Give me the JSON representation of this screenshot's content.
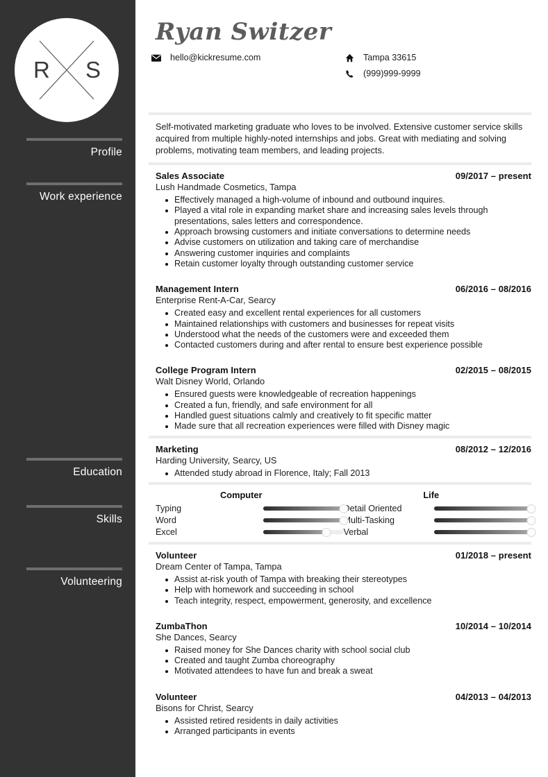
{
  "logo": {
    "left_letter": "R",
    "right_letter": "S"
  },
  "sidebar": {
    "sections": [
      {
        "label": "Profile"
      },
      {
        "label": "Work experience"
      },
      {
        "label": "Education"
      },
      {
        "label": "Skills"
      },
      {
        "label": "Volunteering"
      }
    ]
  },
  "header": {
    "name": "Ryan Switzer",
    "email": "hello@kickresume.com",
    "address": "Tampa 33615",
    "phone": "(999)999-9999",
    "email_icon": "envelope-icon",
    "address_icon": "home-icon",
    "phone_icon": "phone-icon"
  },
  "profile": {
    "text": "Self-motivated marketing graduate who loves to be involved. Extensive customer service skills acquired from multiple highly-noted internships and jobs. Great with mediating and solving problems, motivating team members, and leading projects."
  },
  "work_experience": [
    {
      "title": "Sales Associate",
      "date": "09/2017 – present",
      "organization": "Lush Handmade Cosmetics, Tampa",
      "bullets": [
        "Effectively managed a high-volume of inbound and outbound inquires.",
        "Played a vital role in expanding market share and increasing sales levels through presentations, sales letters and correspondence.",
        "Approach browsing customers and initiate conversations to determine needs",
        "Advise customers on utilization and taking care of merchandise",
        "Answering customer inquiries and complaints",
        "Retain customer loyalty through outstanding customer service"
      ]
    },
    {
      "title": "Management Intern",
      "date": "06/2016 – 08/2016",
      "organization": "Enterprise Rent-A-Car, Searcy",
      "bullets": [
        "Created easy and excellent rental experiences for all customers",
        "Maintained relationships with customers and businesses for repeat visits",
        "Understood what the needs of the customers were and exceeded them",
        "Contacted customers during and after rental to ensure best experience possible"
      ]
    },
    {
      "title": "College Program Intern",
      "date": "02/2015 – 08/2015",
      "organization": "Walt Disney World, Orlando",
      "bullets": [
        "Ensured guests were knowledgeable of recreation happenings",
        "Created a fun, friendly, and safe environment for all",
        "Handled guest situations calmly and creatively to fit specific matter",
        "Made sure that all recreation experiences were filled with Disney magic"
      ]
    }
  ],
  "education": [
    {
      "title": "Marketing",
      "date": "08/2012 – 12/2016",
      "organization": "Harding University, Searcy, US",
      "bullets": [
        "Attended study abroad in Florence, Italy; Fall 2013"
      ]
    }
  ],
  "skills": {
    "columns": [
      {
        "heading": "Computer"
      },
      {
        "heading": "Life"
      }
    ],
    "computer": [
      {
        "name": "Typing",
        "level": 100
      },
      {
        "name": "Word",
        "level": 100
      },
      {
        "name": "Excel",
        "level": 79
      }
    ],
    "life": [
      {
        "name": "Detail Oriented",
        "level": 100
      },
      {
        "name": "Multi-Tasking",
        "level": 100
      },
      {
        "name": "Verbal",
        "level": 100
      }
    ]
  },
  "volunteering": [
    {
      "title": "Volunteer",
      "date": "01/2018 – present",
      "organization": "Dream Center of Tampa, Tampa",
      "bullets": [
        "Assist at-risk youth of Tampa with breaking their stereotypes",
        "Help with homework and succeeding in school",
        "Teach integrity, respect, empowerment, generosity, and excellence"
      ]
    },
    {
      "title": "ZumbaThon",
      "date": "10/2014 – 10/2014",
      "organization": "She Dances, Searcy",
      "bullets": [
        "Raised money for She Dances charity with school social club",
        "Created and taught Zumba choreography",
        "Motivated attendees to have fun and break a sweat"
      ]
    },
    {
      "title": "Volunteer",
      "date": "04/2013 – 04/2013",
      "organization": "Bisons for Christ, Searcy",
      "bullets": [
        "Assisted retired residents in daily activities",
        "Arranged participants in events"
      ]
    }
  ],
  "colors": {
    "sidebar_bg": "#333333",
    "sidebar_rule": "#6e6e6e",
    "name_color": "#5c5c5c",
    "divider": "#ececec",
    "slider_dark": "#2b2b2b",
    "slider_light": "#a7a7a7",
    "slider_track": "#eeeeee"
  }
}
